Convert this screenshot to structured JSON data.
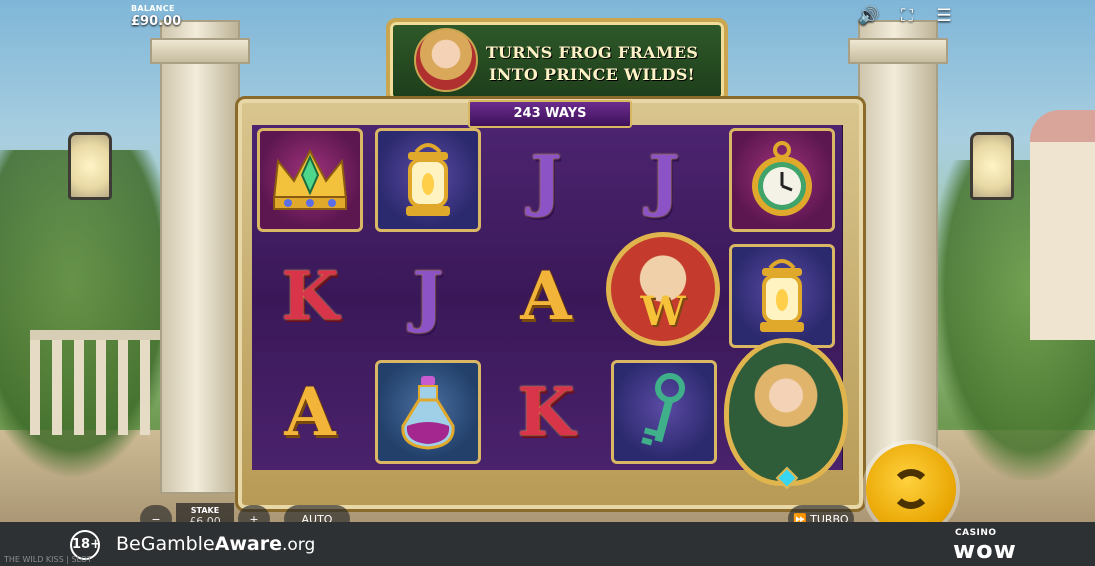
{
  "balance": {
    "label": "BALANCE",
    "value": "£90.00"
  },
  "banner": {
    "line1": "TURNS FROG FRAMES",
    "line2": "INTO PRINCE WILDS!"
  },
  "ways": "243 WAYS",
  "hud": {
    "sound_icon": "speaker-icon",
    "fullscreen_icon": "fullscreen-icon",
    "menu_icon": "hamburger-menu-icon"
  },
  "reels": [
    [
      "crown",
      "K",
      "A"
    ],
    [
      "lantern",
      "J",
      "potion"
    ],
    [
      "J",
      "A",
      "K"
    ],
    [
      "J",
      "prince-wild",
      "key"
    ],
    [
      "pocket-watch",
      "lantern",
      "princess"
    ]
  ],
  "wild_letter": "W",
  "controls": {
    "minus": "−",
    "plus": "+",
    "stake_label": "STAKE",
    "stake_value": "£6.00",
    "auto": "AUTO",
    "turbo": "TURBO",
    "turbo_icon": "fast-forward-icon",
    "spin_icon": "spin-arrows-icon"
  },
  "footer": {
    "age": "18+",
    "gamble_aware_be": "BeGamble",
    "gamble_aware_aware": "Aware",
    "gamble_aware_org": ".org",
    "casino_label": "CASINO",
    "casino_logo": "wow",
    "game_name": "THE WILD KISS | SLOT"
  },
  "colors": {
    "reel_bg": "#3a1858",
    "gold": "#d9b764",
    "spin": "#f2b800",
    "footer": "#2e3133"
  }
}
